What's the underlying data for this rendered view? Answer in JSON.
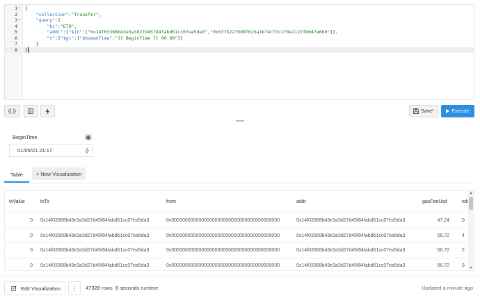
{
  "editor": {
    "lines": [
      {
        "num": "1",
        "fold": true,
        "parts": [
          [
            "p",
            "{"
          ]
        ]
      },
      {
        "num": "2",
        "fold": false,
        "parts": [
          [
            "p",
            "    "
          ],
          [
            "key",
            "\"collection\""
          ],
          [
            "p",
            ":"
          ],
          [
            "str",
            "\"Transfer\""
          ],
          [
            "p",
            ","
          ]
        ]
      },
      {
        "num": "3",
        "fold": true,
        "parts": [
          [
            "p",
            "    "
          ],
          [
            "key",
            "\"query\""
          ],
          [
            "p",
            ":{"
          ]
        ]
      },
      {
        "num": "4",
        "fold": false,
        "parts": [
          [
            "p",
            "        "
          ],
          [
            "key",
            "\"bc\""
          ],
          [
            "p",
            ":"
          ],
          [
            "str",
            "\"ETH\""
          ],
          [
            "p",
            ","
          ]
        ]
      },
      {
        "num": "5",
        "fold": false,
        "parts": [
          [
            "p",
            "        "
          ],
          [
            "key",
            "\"addr\""
          ],
          [
            "p",
            ":{"
          ],
          [
            "key",
            "\"$in\""
          ],
          [
            "p",
            ":["
          ],
          [
            "str",
            "\"0x14f03368b43e3a3d27d45f84fabd61cc07ea5da3\""
          ],
          [
            "p",
            ","
          ],
          [
            "str",
            "\"0x537b2279d8f625a1b74cf3c1f0e2122fb047a6b0\""
          ],
          [
            "p",
            "]},"
          ]
        ]
      },
      {
        "num": "6",
        "fold": false,
        "parts": [
          [
            "p",
            "        "
          ],
          [
            "key",
            "\"t\""
          ],
          [
            "p",
            ":{"
          ],
          [
            "key",
            "\"$gt\""
          ],
          [
            "p",
            ":{"
          ],
          [
            "key",
            "\"$humanTime\""
          ],
          [
            "p",
            ":"
          ],
          [
            "str",
            "\"{{ BeginTime }} 00:00\""
          ],
          [
            "p",
            "}}"
          ]
        ]
      },
      {
        "num": "7",
        "fold": false,
        "parts": [
          [
            "p",
            "    }"
          ]
        ]
      },
      {
        "num": "8",
        "fold": false,
        "parts": [
          [
            "p",
            "}"
          ]
        ]
      }
    ],
    "active_line": 7
  },
  "toolbar": {
    "format_label": "{{ }}",
    "save_label": "Save*",
    "execute_label": "Execute"
  },
  "parameter": {
    "label": "BeginTime",
    "value": "01/05/21 21:17"
  },
  "tabs": {
    "table_label": "Table",
    "new_vis_label": "+ New Visualization"
  },
  "table": {
    "columns": [
      "txValue",
      "txTo",
      "from",
      "addr",
      "gasFeeUsd",
      "tok"
    ],
    "rows": [
      [
        "0",
        "0x14f03368b43e3a3d27d45f84fabd61cc07ea5da3",
        "0x0000000000000000000000000000000000000000",
        "0x14f03368b43e3a3d27d45f84fabd61cc07ea5da3",
        "47.24",
        "0"
      ],
      [
        "0",
        "0x14f03368b43e3a3d27d45f84fabd61cc07ea5da3",
        "0x0000000000000000000000000000000000000000",
        "0x14f03368b43e3a3d27d45f84fabd61cc07ea5da3",
        "56.72",
        "4"
      ],
      [
        "0",
        "0x14f03368b43e3a3d27d45f84fabd61cc07ea5da3",
        "0x0000000000000000000000000000000000000000",
        "0x14f03368b43e3a3d27d45f84fabd61cc07ea5da3",
        "56.72",
        "2"
      ],
      [
        "0",
        "0x14f03368b43e3a3d27d45f84fabd61cc07ea5da3",
        "0x0000000000000000000000000000000000000000",
        "0x14f03368b43e3a3d27d45f84fabd61cc07ea5da3",
        "56.72",
        "3"
      ]
    ]
  },
  "footer": {
    "edit_label": "Edit Visualization",
    "more_label": "⋮",
    "row_count": "47328",
    "rows_word": "rows",
    "runtime": "6 seconds",
    "runtime_word": "runtime",
    "updated": "Updated a minute ago"
  },
  "colors": {
    "accent": "#2d8fe0",
    "code_key": "#2a6fb6",
    "code_string": "#1a7a1a"
  },
  "icons": [
    "format-icon",
    "schema-icon",
    "autocomplete-bolt-icon",
    "save-icon",
    "play-icon",
    "gear-icon",
    "bolt-icon",
    "edit-icon",
    "more-icon"
  ]
}
